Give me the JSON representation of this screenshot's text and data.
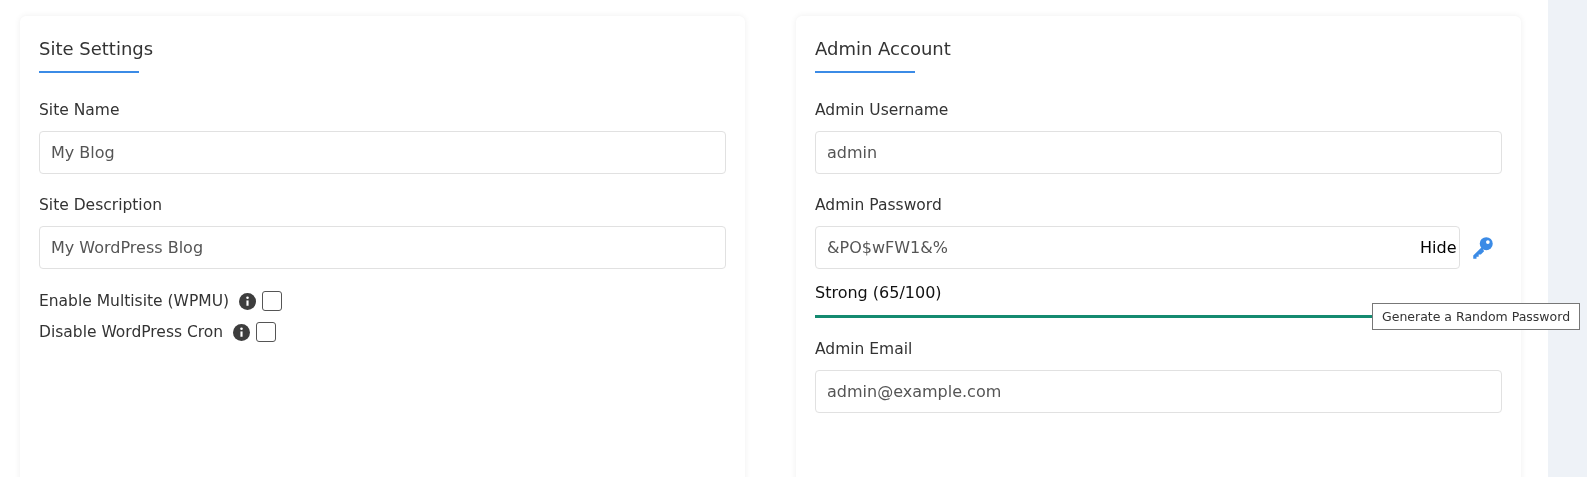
{
  "site_settings": {
    "title": "Site Settings",
    "fields": [
      {
        "label": "Site Name",
        "value": "My Blog"
      },
      {
        "label": "Site Description",
        "value": "My WordPress Blog"
      }
    ],
    "options": [
      {
        "label": "Enable Multisite (WPMU)",
        "checked": false
      },
      {
        "label": "Disable WordPress Cron",
        "checked": false
      }
    ]
  },
  "admin_account": {
    "title": "Admin Account",
    "username": {
      "label": "Admin Username",
      "value": "admin"
    },
    "password": {
      "label": "Admin Password",
      "value": "&PO$wFW1&%",
      "toggle": "Hide",
      "tooltip": "Generate a Random Password"
    },
    "strength": {
      "text": "Strong (65/100)",
      "level": 1
    },
    "email": {
      "label": "Admin Email",
      "value": "admin@example.com"
    }
  }
}
